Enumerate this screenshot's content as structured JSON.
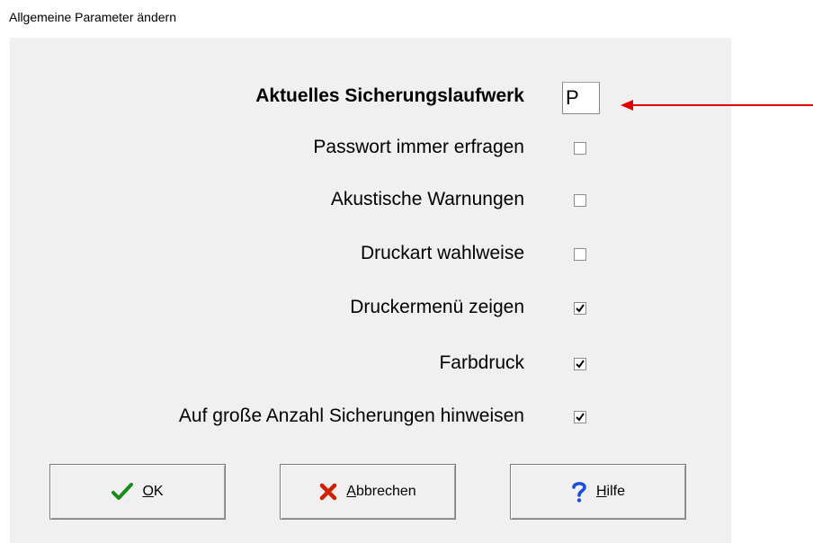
{
  "window": {
    "title": "Allgemeine Parameter ändern"
  },
  "drive": {
    "label": "Aktuelles Sicherungslaufwerk",
    "value": "P"
  },
  "options": [
    {
      "label": "Passwort immer erfragen",
      "checked": false
    },
    {
      "label": "Akustische Warnungen",
      "checked": false
    },
    {
      "label": "Druckart wahlweise",
      "checked": false
    },
    {
      "label": "Druckermenü zeigen",
      "checked": true
    },
    {
      "label": "Farbdruck",
      "checked": true
    },
    {
      "label": "Auf große Anzahl Sicherungen hinweisen",
      "checked": true
    }
  ],
  "buttons": {
    "ok": {
      "mnemonic": "O",
      "rest": "K"
    },
    "cancel": {
      "mnemonic": "A",
      "rest": "bbrechen"
    },
    "help": {
      "mnemonic": "H",
      "rest": "ilfe"
    }
  },
  "colors": {
    "panel": "#f0f0f0",
    "arrow": "#e00000",
    "ok_check": "#1a8a1a",
    "cancel_x": "#cc2200",
    "help_q": "#1a4fd6"
  },
  "icons": {
    "ok": "check-icon",
    "cancel": "x-icon",
    "help": "question-icon",
    "annotation": "arrow-left-icon"
  }
}
